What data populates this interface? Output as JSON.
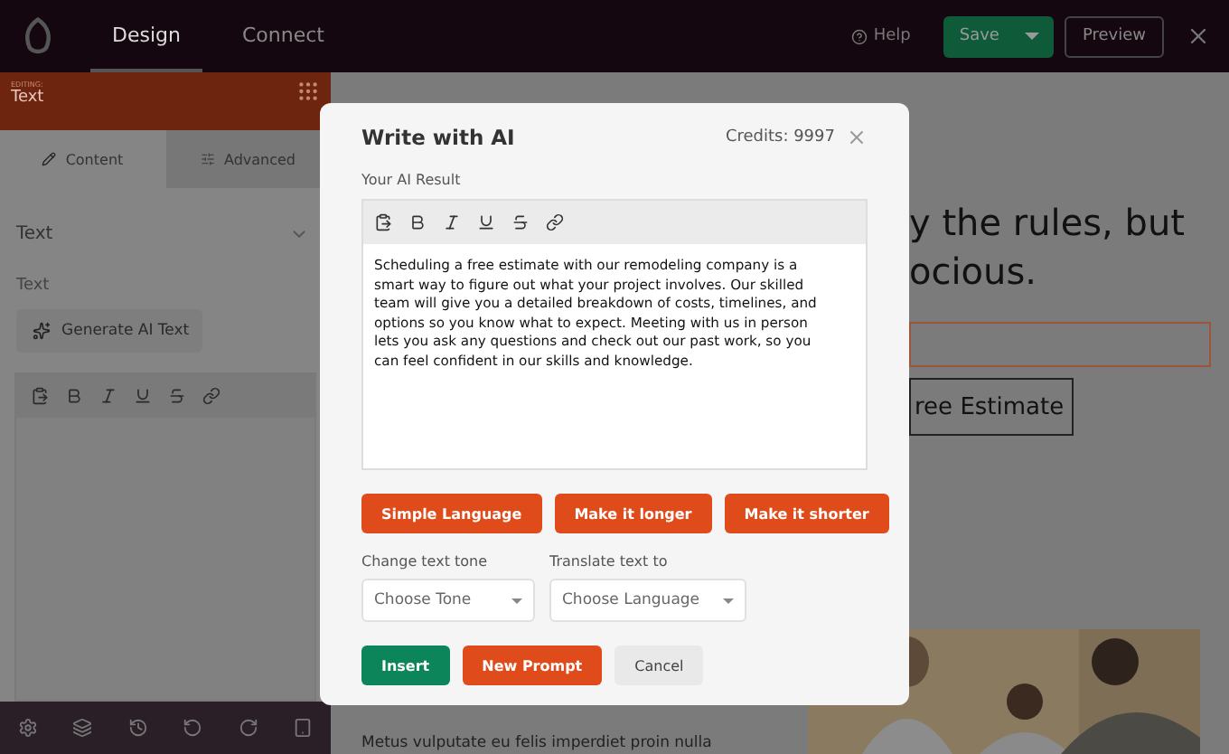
{
  "topbar": {
    "tabs": [
      {
        "label": "Design",
        "selected": true
      },
      {
        "label": "Connect",
        "selected": false
      }
    ],
    "help": "Help",
    "save": "Save",
    "preview": "Preview"
  },
  "sidebar": {
    "editing_label": "EDITING:",
    "editing_title": "Text",
    "tabs": [
      {
        "label": "Content",
        "selected": true
      },
      {
        "label": "Advanced",
        "selected": false
      }
    ],
    "section": {
      "title": "Text",
      "expanded": true
    },
    "field_label": "Text",
    "generate_button": "Generate AI Text"
  },
  "canvas": {
    "headline": [
      "y the rules, but",
      "ocious."
    ],
    "button": "ree Estimate",
    "paragraph": "Metus vulputate eu felis imperdiet proin nulla"
  },
  "modal": {
    "title": "Write with AI",
    "credits": "Credits: 9997",
    "result_label": "Your AI Result",
    "result_text": "Scheduling a free estimate with our remodeling company is a smart way to figure out what your project involves. Our skilled team will give you a detailed breakdown of costs, timelines, and options so you know what to expect. Meeting with us in person lets you ask any questions and check out our past work, so you can feel confident in our skills and knowledge.",
    "actions": [
      "Simple Language",
      "Make it longer",
      "Make it shorter"
    ],
    "tone": {
      "label": "Change text tone",
      "placeholder": "Choose Tone"
    },
    "translate": {
      "label": "Translate text to",
      "placeholder": "Choose Language"
    },
    "buttons": [
      {
        "label": "Insert",
        "kind": "primary"
      },
      {
        "label": "New Prompt",
        "kind": "accent"
      },
      {
        "label": "Cancel",
        "kind": "secondary"
      }
    ]
  }
}
